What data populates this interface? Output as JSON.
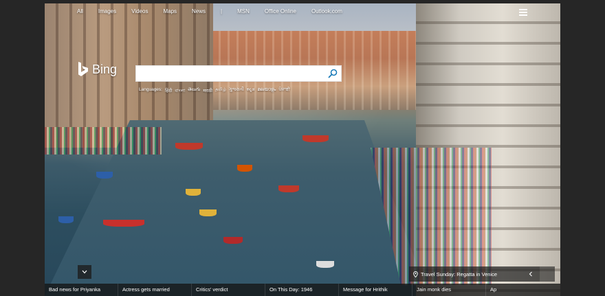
{
  "nav": {
    "items": [
      "All",
      "Images",
      "Videos",
      "Maps",
      "News",
      "|",
      "MSN",
      "Office Online",
      "Outlook.com"
    ]
  },
  "logo": {
    "text": "Bing"
  },
  "search": {
    "value": "",
    "placeholder": ""
  },
  "languages": {
    "label": "Languages:",
    "items": [
      "हिंदी",
      "বাংলা",
      "తెలుగు",
      "मराठी",
      "தமிழ்",
      "ગુજરાતી",
      "ಕನ್ನಡ",
      "മലയാളം",
      "ਪੰਜਾਬੀ"
    ]
  },
  "caption": {
    "text": "Travel Sunday: Regatta in Venice"
  },
  "news": [
    "Bad news for Priyanka",
    "Actress gets married",
    "Critics' verdict",
    "On This Day: 1946",
    "Message for Hrithik",
    "Jain monk dies",
    "Ap"
  ],
  "colors": {
    "search_icon": "#1a7bb9",
    "bar_bg": "#141414"
  },
  "icons": {
    "search": "search-icon",
    "menu": "hamburger-menu-icon",
    "collapse": "chevron-down-icon",
    "location": "location-pin-icon",
    "prev": "chevron-left-icon"
  }
}
